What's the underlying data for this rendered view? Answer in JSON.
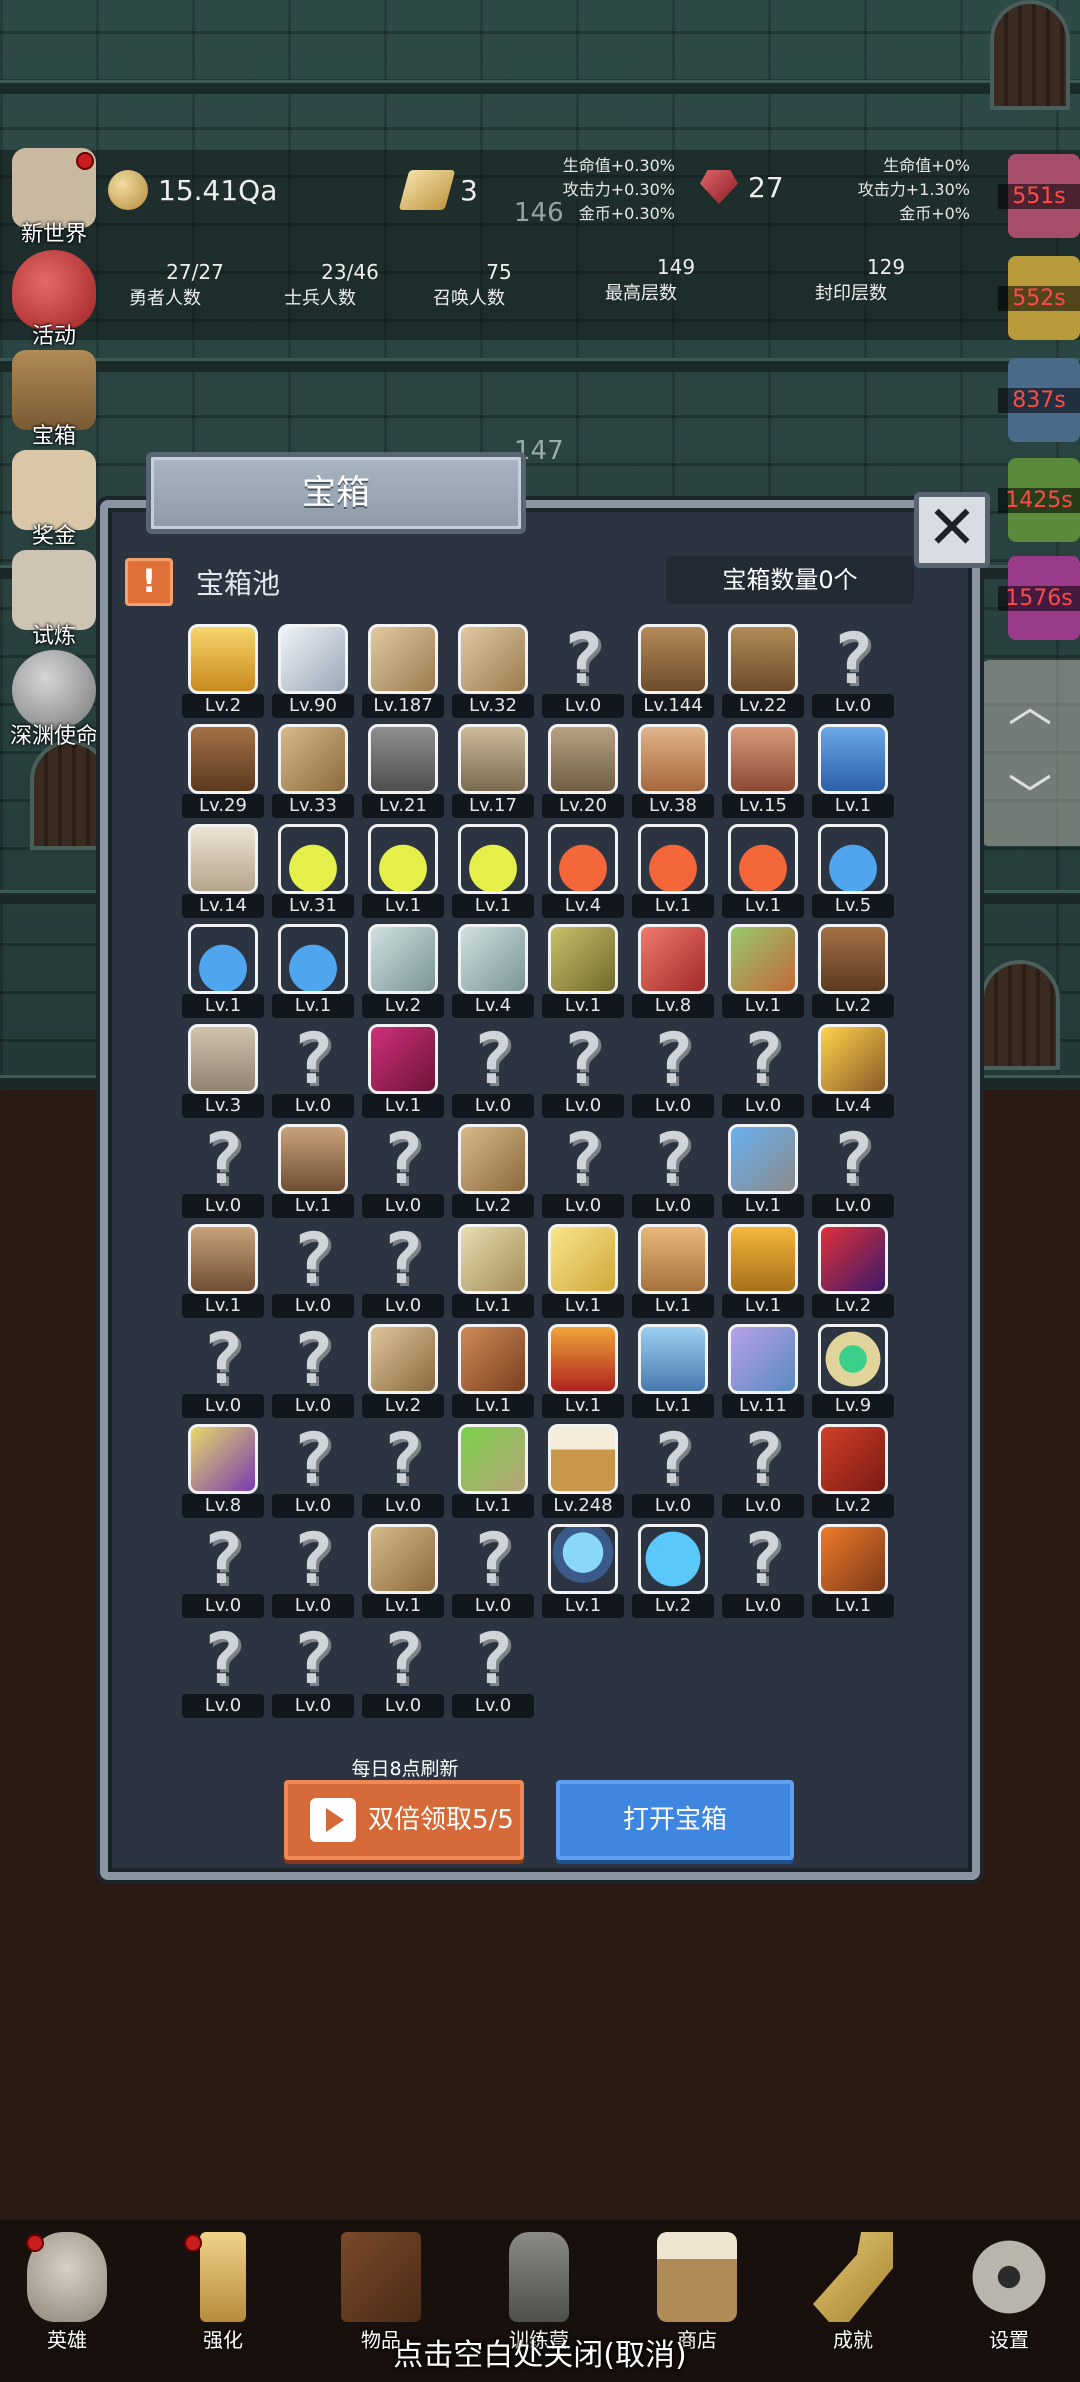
{
  "hud": {
    "coins": "15.41Qa",
    "bars": "3",
    "gems": "27",
    "bonus_left": [
      "生命值+0.30%",
      "攻击力+0.30%",
      "金币+0.30%"
    ],
    "bonus_right": [
      "生命值+0%",
      "攻击力+1.30%",
      "金币+0%"
    ],
    "ghost_floor_a": "146",
    "ghost_floor_b": "147",
    "stats": [
      {
        "value": "27/27",
        "label": "勇者人数"
      },
      {
        "value": "23/46",
        "label": "士兵人数"
      },
      {
        "value": "75",
        "label": "召唤人数"
      },
      {
        "value": "149",
        "label": "最高层数"
      },
      {
        "value": "129",
        "label": "封印层数"
      }
    ]
  },
  "left_menu": [
    "新世界",
    "活动",
    "宝箱",
    "奖金",
    "试炼",
    "深渊使命"
  ],
  "right_timers": [
    "551s",
    "552s",
    "837s",
    "1425s",
    "1576s"
  ],
  "scroll": {
    "up": "︿",
    "down": "﹀"
  },
  "dialog": {
    "title": "宝箱",
    "close": "✕",
    "pool_icon": "!",
    "pool_label": "宝箱池",
    "chest_count": "宝箱数量0个",
    "refresh_note": "每日8点刷新",
    "double_claim": "双倍领取5/5",
    "open_chest": "打开宝箱"
  },
  "items": [
    {
      "icon": "crown-icon",
      "lv": "Lv.2"
    },
    {
      "icon": "diamond-icon",
      "lv": "Lv.90"
    },
    {
      "icon": "sword-icon",
      "lv": "Lv.187"
    },
    {
      "icon": "sword-icon",
      "lv": "Lv.32"
    },
    {
      "icon": "unknown-icon",
      "lv": "Lv.0"
    },
    {
      "icon": "helmet-icon",
      "lv": "Lv.144"
    },
    {
      "icon": "backpack-icon",
      "lv": "Lv.22"
    },
    {
      "icon": "unknown-icon",
      "lv": "Lv.0"
    },
    {
      "icon": "leather-helmet-icon",
      "lv": "Lv.29"
    },
    {
      "icon": "dagger-icon",
      "lv": "Lv.33"
    },
    {
      "icon": "knight-helmet-icon",
      "lv": "Lv.21"
    },
    {
      "icon": "hammer-icon",
      "lv": "Lv.17"
    },
    {
      "icon": "great-helm-icon",
      "lv": "Lv.20"
    },
    {
      "icon": "meat-icon",
      "lv": "Lv.38"
    },
    {
      "icon": "steak-icon",
      "lv": "Lv.15"
    },
    {
      "icon": "pouch-icon",
      "lv": "Lv.1"
    },
    {
      "icon": "flour-icon",
      "lv": "Lv.14"
    },
    {
      "icon": "yellow-potion-icon",
      "lv": "Lv.31"
    },
    {
      "icon": "yellow-potion-icon",
      "lv": "Lv.1"
    },
    {
      "icon": "yellow-potion-icon",
      "lv": "Lv.1"
    },
    {
      "icon": "red-potion-icon",
      "lv": "Lv.4"
    },
    {
      "icon": "red-potion-icon",
      "lv": "Lv.1"
    },
    {
      "icon": "red-potion-icon",
      "lv": "Lv.1"
    },
    {
      "icon": "blue-potion-icon",
      "lv": "Lv.5"
    },
    {
      "icon": "blue-potion-icon",
      "lv": "Lv.1"
    },
    {
      "icon": "blue-potion-icon",
      "lv": "Lv.1"
    },
    {
      "icon": "grey-potion-icon",
      "lv": "Lv.2"
    },
    {
      "icon": "grey-potion-icon",
      "lv": "Lv.4"
    },
    {
      "icon": "olive-potion-icon",
      "lv": "Lv.1"
    },
    {
      "icon": "red-vial-icon",
      "lv": "Lv.8"
    },
    {
      "icon": "winged-boot-icon",
      "lv": "Lv.1"
    },
    {
      "icon": "boot-icon",
      "lv": "Lv.2"
    },
    {
      "icon": "shoe-icon",
      "lv": "Lv.3"
    },
    {
      "icon": "unknown-icon",
      "lv": "Lv.0"
    },
    {
      "icon": "pink-boot-icon",
      "lv": "Lv.1"
    },
    {
      "icon": "unknown-icon",
      "lv": "Lv.0"
    },
    {
      "icon": "unknown-icon",
      "lv": "Lv.0"
    },
    {
      "icon": "unknown-icon",
      "lv": "Lv.0"
    },
    {
      "icon": "unknown-icon",
      "lv": "Lv.0"
    },
    {
      "icon": "torch-icon",
      "lv": "Lv.4"
    },
    {
      "icon": "unknown-icon",
      "lv": "Lv.0"
    },
    {
      "icon": "mushroom-icon",
      "lv": "Lv.1"
    },
    {
      "icon": "unknown-icon",
      "lv": "Lv.0"
    },
    {
      "icon": "staff-icon",
      "lv": "Lv.2"
    },
    {
      "icon": "unknown-icon",
      "lv": "Lv.0"
    },
    {
      "icon": "unknown-icon",
      "lv": "Lv.0"
    },
    {
      "icon": "wand-icon",
      "lv": "Lv.1"
    },
    {
      "icon": "unknown-icon",
      "lv": "Lv.0"
    },
    {
      "icon": "bag-icon",
      "lv": "Lv.1"
    },
    {
      "icon": "unknown-icon",
      "lv": "Lv.0"
    },
    {
      "icon": "unknown-icon",
      "lv": "Lv.0"
    },
    {
      "icon": "club-icon",
      "lv": "Lv.1"
    },
    {
      "icon": "cheese-icon",
      "lv": "Lv.1"
    },
    {
      "icon": "pie-icon",
      "lv": "Lv.1"
    },
    {
      "icon": "honey-jar-icon",
      "lv": "Lv.1"
    },
    {
      "icon": "crystal-icon",
      "lv": "Lv.2"
    },
    {
      "icon": "unknown-icon",
      "lv": "Lv.0"
    },
    {
      "icon": "unknown-icon",
      "lv": "Lv.0"
    },
    {
      "icon": "bow-icon",
      "lv": "Lv.2"
    },
    {
      "icon": "quiver-icon",
      "lv": "Lv.1"
    },
    {
      "icon": "shield-icon",
      "lv": "Lv.1"
    },
    {
      "icon": "armor-icon",
      "lv": "Lv.1"
    },
    {
      "icon": "dragon-emblem-icon",
      "lv": "Lv.11"
    },
    {
      "icon": "amulet-icon",
      "lv": "Lv.9"
    },
    {
      "icon": "scroll-icon",
      "lv": "Lv.8"
    },
    {
      "icon": "unknown-icon",
      "lv": "Lv.0"
    },
    {
      "icon": "unknown-icon",
      "lv": "Lv.0"
    },
    {
      "icon": "green-wand-icon",
      "lv": "Lv.1"
    },
    {
      "icon": "beer-mug-icon",
      "lv": "Lv.248"
    },
    {
      "icon": "unknown-icon",
      "lv": "Lv.0"
    },
    {
      "icon": "unknown-icon",
      "lv": "Lv.0"
    },
    {
      "icon": "spellbook-icon",
      "lv": "Lv.2"
    },
    {
      "icon": "unknown-icon",
      "lv": "Lv.0"
    },
    {
      "icon": "unknown-icon",
      "lv": "Lv.0"
    },
    {
      "icon": "harp-icon",
      "lv": "Lv.1"
    },
    {
      "icon": "unknown-icon",
      "lv": "Lv.0"
    },
    {
      "icon": "crystal-ball-icon",
      "lv": "Lv.1"
    },
    {
      "icon": "rune-disc-icon",
      "lv": "Lv.2"
    },
    {
      "icon": "unknown-icon",
      "lv": "Lv.0"
    },
    {
      "icon": "arrow-icon",
      "lv": "Lv.1"
    },
    {
      "icon": "unknown-icon",
      "lv": "Lv.0"
    },
    {
      "icon": "unknown-icon",
      "lv": "Lv.0"
    },
    {
      "icon": "unknown-icon",
      "lv": "Lv.0"
    },
    {
      "icon": "unknown-icon",
      "lv": "Lv.0"
    }
  ],
  "bottom_nav": [
    "英雄",
    "强化",
    "物品",
    "训练营",
    "商店",
    "成就",
    "设置"
  ],
  "close_hint": "点击空白处关闭(取消)",
  "colors": {
    "accent_orange": "#d56a38",
    "accent_blue": "#3f86e0",
    "panel": "#2b3440",
    "timer_red": "#ff4a4a"
  }
}
